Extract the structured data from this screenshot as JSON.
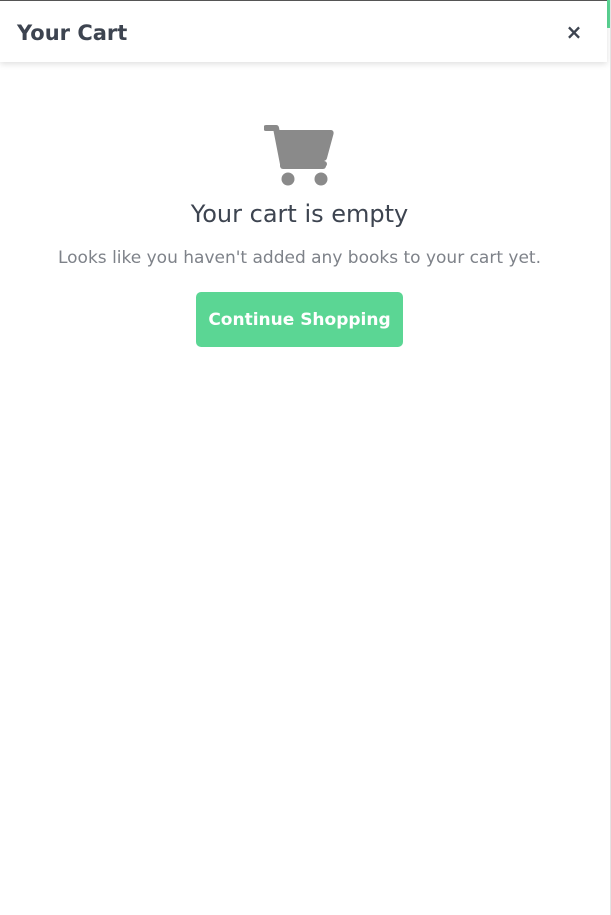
{
  "header": {
    "title": "Your Cart",
    "close_label": "×"
  },
  "empty_state": {
    "icon": "shopping-cart-icon",
    "title": "Your cart is empty",
    "message": "Looks like you haven't added any books to your cart yet.",
    "button_label": "Continue Shopping"
  },
  "colors": {
    "accent": "#5bd694",
    "heading": "#3d4450",
    "muted_text": "#7e8289",
    "icon": "#8a8a8a"
  }
}
